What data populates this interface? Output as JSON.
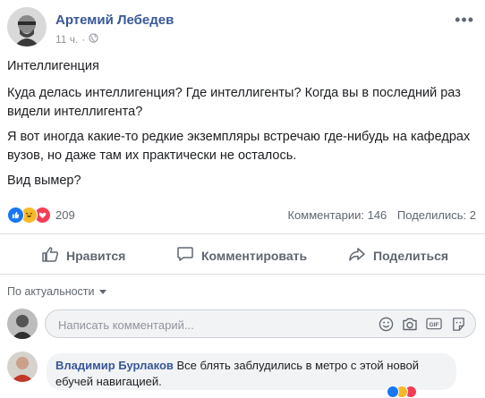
{
  "post": {
    "author": "Артемий Лебедев",
    "time": "11 ч.",
    "paragraphs": [
      "Интеллигенция",
      "Куда делась интеллигенция? Где интеллигенты? Когда вы в последний раз видели интеллигента?",
      "Я вот иногда какие-то редкие экземпляры встречаю где-нибудь на кафедрах вузов, но даже там их практически не осталось.",
      "Вид вымер?"
    ]
  },
  "reactions": {
    "count": "209",
    "comments_label": "Комментарии: 146",
    "shares_label": "Поделились: 2",
    "colors": {
      "like": "#1877f2",
      "haha": "#f7b928",
      "love": "#f33e58"
    }
  },
  "actions": {
    "like": "Нравится",
    "comment": "Комментировать",
    "share": "Поделиться"
  },
  "comments": {
    "sort_label": "По актуальности",
    "input_placeholder": "Написать комментарий...",
    "gif_label": "GIF",
    "items": [
      {
        "author": "Владимир Бурлаков",
        "text": "Все блять заблудились в метро с этой новой ебучей навигацией."
      }
    ]
  }
}
